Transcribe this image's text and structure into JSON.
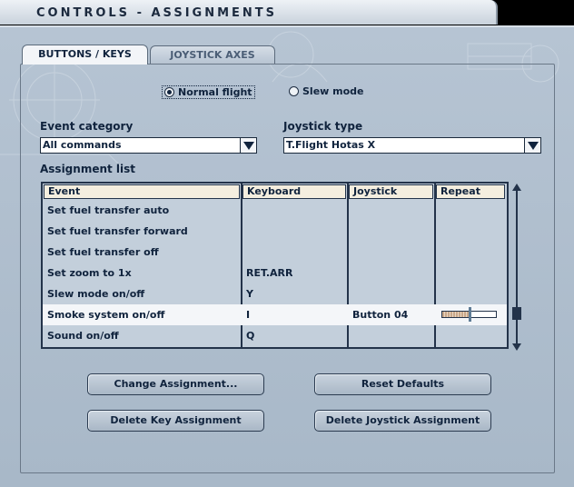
{
  "window": {
    "title": "CONTROLS - ASSIGNMENTS"
  },
  "tabs": [
    {
      "label": "BUTTONS / KEYS",
      "active": true
    },
    {
      "label": "JOYSTICK AXES",
      "active": false
    }
  ],
  "mode": {
    "options": [
      {
        "label": "Normal flight",
        "selected": true
      },
      {
        "label": "Slew mode",
        "selected": false
      }
    ]
  },
  "event_category": {
    "label": "Event category",
    "value": "All commands"
  },
  "joystick_type": {
    "label": "Joystick type",
    "value": "T.Flight Hotas X"
  },
  "assignment_list": {
    "label": "Assignment list",
    "columns": [
      "Event",
      "Keyboard",
      "Joystick",
      "Repeat"
    ],
    "rows": [
      {
        "event": "Set fuel transfer auto",
        "keyboard": "",
        "joystick": "",
        "repeat": null,
        "selected": false
      },
      {
        "event": "Set fuel transfer forward",
        "keyboard": "",
        "joystick": "",
        "repeat": null,
        "selected": false
      },
      {
        "event": "Set fuel transfer off",
        "keyboard": "",
        "joystick": "",
        "repeat": null,
        "selected": false
      },
      {
        "event": "Set zoom to 1x",
        "keyboard": "RET.ARR",
        "joystick": "",
        "repeat": null,
        "selected": false
      },
      {
        "event": "Slew mode on/off",
        "keyboard": "Y",
        "joystick": "",
        "repeat": null,
        "selected": false
      },
      {
        "event": "Smoke system on/off",
        "keyboard": "I",
        "joystick": "Button 04",
        "repeat": 0.5,
        "selected": true
      },
      {
        "event": "Sound on/off",
        "keyboard": "Q",
        "joystick": "",
        "repeat": null,
        "selected": false
      }
    ]
  },
  "buttons": {
    "change_assignment": "Change Assignment...",
    "reset_defaults": "Reset Defaults",
    "delete_key_assignment": "Delete Key Assignment",
    "delete_joystick_assignment": "Delete Joystick Assignment"
  },
  "colors": {
    "panel_bg": "#b6c4d3",
    "header_bg": "#f4eedf",
    "text": "#10233d",
    "selected_row": "#f4f6f9"
  }
}
